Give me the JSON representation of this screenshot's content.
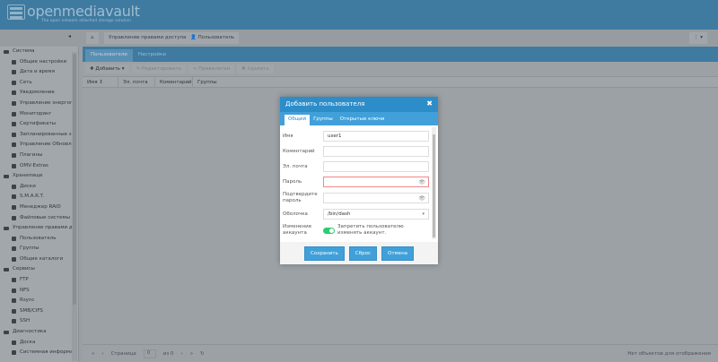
{
  "header": {
    "brand": "openmediavault",
    "tagline": "The open network attached storage solution"
  },
  "breadcrumb": [
    "Управление правами доступа",
    "Пользователь"
  ],
  "sidebar": [
    {
      "label": "Система",
      "group": true
    },
    {
      "label": "Общие настройки"
    },
    {
      "label": "Дата и время"
    },
    {
      "label": "Сеть"
    },
    {
      "label": "Уведомление"
    },
    {
      "label": "Управление энергопотреблением"
    },
    {
      "label": "Мониторинг"
    },
    {
      "label": "Сертификаты"
    },
    {
      "label": "Запланированные задачи"
    },
    {
      "label": "Управление Обновлениями"
    },
    {
      "label": "Плагины"
    },
    {
      "label": "OMV-Extras"
    },
    {
      "label": "Хранилище",
      "group": true
    },
    {
      "label": "Диски"
    },
    {
      "label": "S.M.A.R.T."
    },
    {
      "label": "Менеджер RAID"
    },
    {
      "label": "Файловые системы"
    },
    {
      "label": "Управление правами доступа",
      "group": true
    },
    {
      "label": "Пользователь"
    },
    {
      "label": "Группы"
    },
    {
      "label": "Общие каталоги"
    },
    {
      "label": "Сервисы",
      "group": true
    },
    {
      "label": "FTP"
    },
    {
      "label": "NFS"
    },
    {
      "label": "Rsync"
    },
    {
      "label": "SMB/CIFS"
    },
    {
      "label": "SSH"
    },
    {
      "label": "Диагностика",
      "group": true
    },
    {
      "label": "Доска"
    },
    {
      "label": "Системная информация"
    }
  ],
  "main": {
    "tabs": [
      "Пользователи",
      "Настройки"
    ],
    "toolbar": {
      "add": "Добавить",
      "edit": "Редактировать",
      "privileges": "Привилегии",
      "delete": "Удалить"
    },
    "columns": [
      "Имя",
      "Эл. почта",
      "Коментарий",
      "Группы"
    ],
    "paging": {
      "page_label": "Страница",
      "page": "0",
      "of": "из 0",
      "status": "Нет объектов для отображения"
    }
  },
  "dialog": {
    "title": "Добавить пользователя",
    "tabs": [
      "Общий",
      "Группы",
      "Открытые ключи"
    ],
    "fields": {
      "name_label": "Имя",
      "name_value": "user1",
      "comment_label": "Коментарий",
      "email_label": "Эл. почта",
      "password_label": "Пароль",
      "confirm_label": "Подтвердите пароль",
      "shell_label": "Оболочка",
      "shell_value": "/bin/dash",
      "change_label": "Изменение аккаунта",
      "change_text": "Запретить пользователю изменять аккаунт.",
      "change_on": true
    },
    "buttons": {
      "save": "Сохранить",
      "reset": "Сброс",
      "cancel": "Отмена"
    }
  },
  "colors": {
    "header": "#3f7aa0",
    "dialog_title": "#2c8dc9",
    "accent": "#41a0d9",
    "toggle": "#2ecc71"
  }
}
